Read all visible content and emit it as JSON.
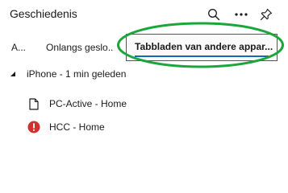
{
  "header": {
    "title": "Geschiedenis",
    "icons": [
      "search-icon",
      "more-icon",
      "pin-icon"
    ]
  },
  "tabs": [
    {
      "label": "A...",
      "selected": false
    },
    {
      "label": "Onlangs geslo...",
      "selected": false
    },
    {
      "label": "Tabbladen van andere appar...",
      "selected": true
    }
  ],
  "colors": {
    "accent": "#0f6cbd",
    "highlight_annotation": "#1aa63a",
    "error": "#d32f2f"
  },
  "device": {
    "label": "iPhone - 1 min geleden",
    "expanded": true
  },
  "items": [
    {
      "label": "PC-Active - Home",
      "icon": "page-icon"
    },
    {
      "label": "HCC - Home",
      "icon": "error-icon"
    }
  ]
}
